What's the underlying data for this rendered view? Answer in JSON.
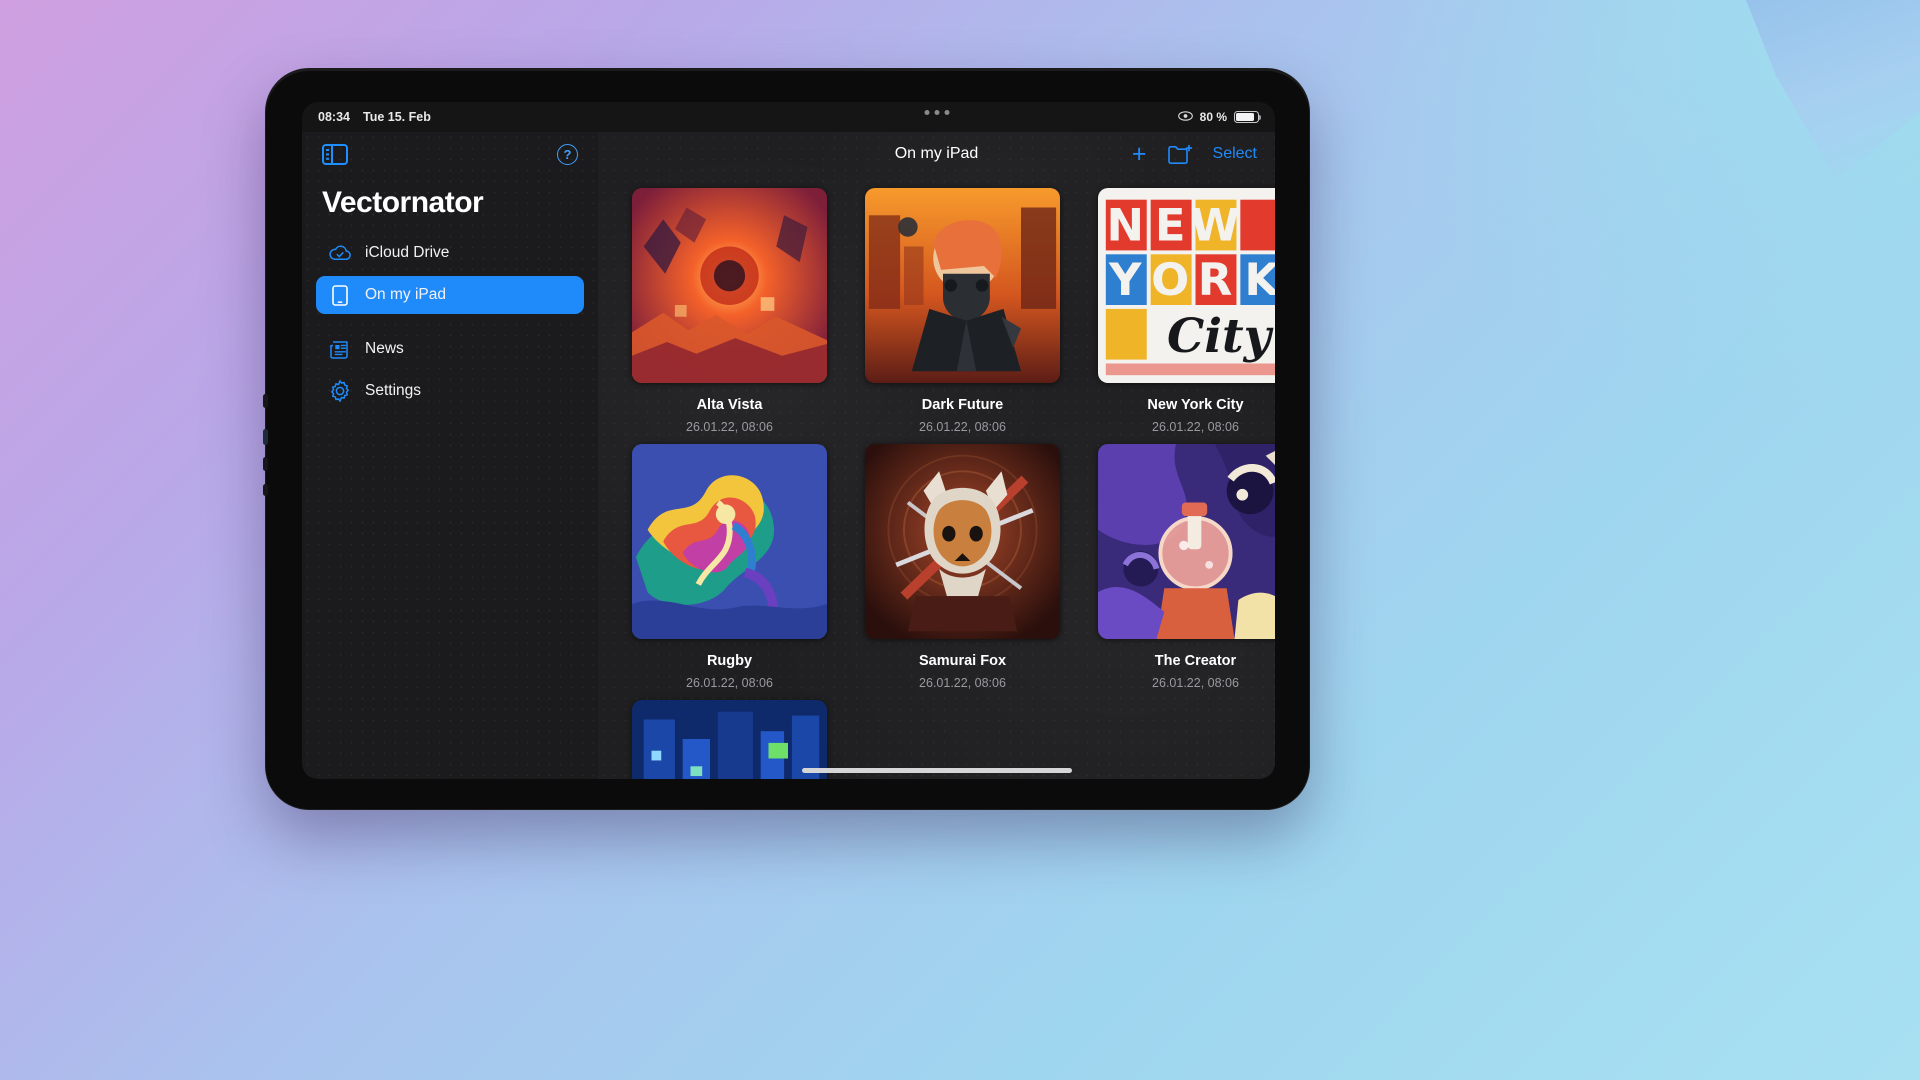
{
  "status_bar": {
    "time": "08:34",
    "date": "Tue 15. Feb",
    "battery_text": "80 %",
    "eye_icon": "eye-icon",
    "battery_icon": "battery-icon",
    "battery_level_percent": 80
  },
  "sidebar": {
    "toggle_icon": "sidebar-toggle-icon",
    "help_icon": "help-icon",
    "help_label": "?",
    "app_title": "Vectornator",
    "items": [
      {
        "label": "iCloud Drive",
        "icon": "icloud-drive-icon",
        "active": false
      },
      {
        "label": "On my iPad",
        "icon": "ipad-icon",
        "active": true
      },
      {
        "label": "News",
        "icon": "news-icon",
        "active": false
      },
      {
        "label": "Settings",
        "icon": "gear-icon",
        "active": false
      }
    ]
  },
  "toolbar": {
    "title": "On my iPad",
    "add_label": "+",
    "add_icon": "plus-icon",
    "new_folder_icon": "new-folder-icon",
    "select_label": "Select"
  },
  "multitasking_dots": "multitasking-handle",
  "documents": [
    {
      "name": "Alta Vista",
      "date": "26.01.22, 08:06",
      "art": "alta-vista"
    },
    {
      "name": "Dark Future",
      "date": "26.01.22, 08:06",
      "art": "dark-future"
    },
    {
      "name": "New York City",
      "date": "26.01.22, 08:06",
      "art": "new-york-city"
    },
    {
      "name": "Rugby",
      "date": "26.01.22, 08:06",
      "art": "rugby"
    },
    {
      "name": "Samurai Fox",
      "date": "26.01.22, 08:06",
      "art": "samurai-fox"
    },
    {
      "name": "The Creator",
      "date": "26.01.22, 08:06",
      "art": "the-creator"
    },
    {
      "name": "",
      "date": "",
      "art": "blue-city"
    }
  ],
  "colors": {
    "accent": "#1f8bfb",
    "sidebar_bg": "#1b1b1d",
    "main_bg": "#1f1f21",
    "text_primary": "#ffffff",
    "text_secondary": "#9a9a9e"
  }
}
